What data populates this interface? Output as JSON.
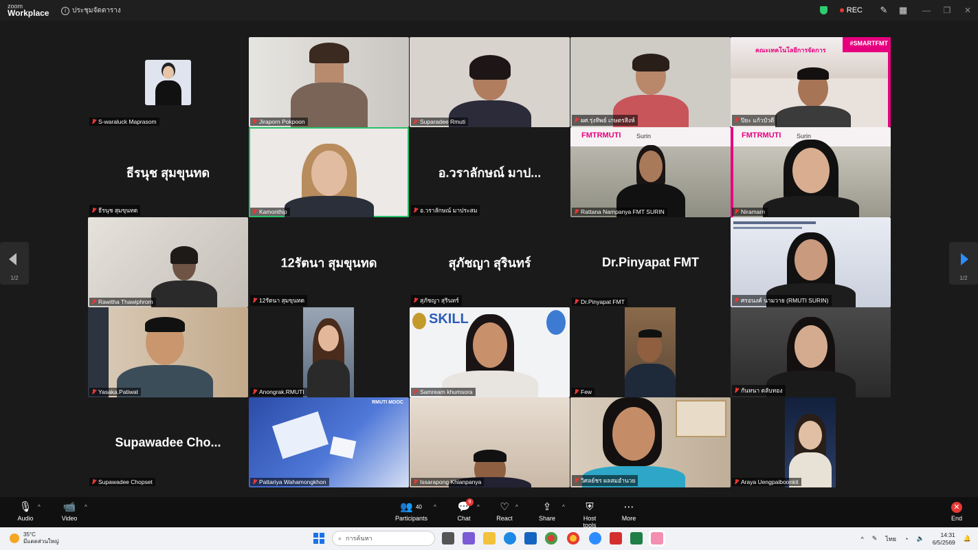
{
  "app": {
    "logo_line1": "zoom",
    "logo_line2": "Workplace",
    "meeting_title": "ประชุมจัดตาราง",
    "rec_label": "REC"
  },
  "pager": {
    "page": "1/2"
  },
  "tiles": [
    {
      "name": "S-waraluck Maprasom"
    },
    {
      "name": "Jiraporn Pokpoon"
    },
    {
      "name": "Suparadee Rmuti"
    },
    {
      "name": "ผศ.รุ่งทิพย์ เกษตรสิงห์"
    },
    {
      "name": "ปิยะ แก้วบัวดี"
    },
    {
      "name": "ธีรนุช สุมขุนทด",
      "display": "ธีรนุช  สุมขุนทด"
    },
    {
      "name": "Kamonthip"
    },
    {
      "name": "อ.วราลักษณ์ มาประสม",
      "display": "อ.วราลักษณ์  มาป..."
    },
    {
      "name": "Rattana Nampanya FMT SURIN"
    },
    {
      "name": "Niramarn"
    },
    {
      "name": "Rawitha Thawiphrom"
    },
    {
      "name": "12รัตนา สุมขุนทด",
      "display": "12รัตนา สุมขุนทด"
    },
    {
      "name": "สุภัชญา สุรินทร์",
      "display": "สุภัชญา สุรินทร์"
    },
    {
      "name": "Dr.Pinyapat FMT",
      "display": "Dr.Pinyapat FMT"
    },
    {
      "name": "ศรอนงค์ นามวาย (RMUTI SURIN)"
    },
    {
      "name": "Yasaka.Patiwat"
    },
    {
      "name": "Anongrak.RMUTI"
    },
    {
      "name": "Samream khumsora"
    },
    {
      "name": "Few"
    },
    {
      "name": "กันทนา ตลับทอง"
    },
    {
      "name": "Supawadee Chopset",
      "display": "Supawadee  Cho..."
    },
    {
      "name": "Pattariya Wahamongkhon"
    },
    {
      "name": "Issarapong Khianpanya"
    },
    {
      "name": "วิศลย์ชร ผลสมอำนวย"
    },
    {
      "name": "Araya Uengpaiboonkit"
    }
  ],
  "backgrounds": {
    "smartfmt_tag": "#SMARTFMT",
    "faculty_banner": "คณะเทคโนโลยีการจัดการ",
    "fmt_logo": "FMTRMUTI",
    "fmt_sub": "Surin",
    "skill_sign": "SKILL",
    "mooc": "RMUTI MOOC"
  },
  "toolbar": {
    "audio": "Audio",
    "video": "Video",
    "participants": "Participants",
    "participants_count": "40",
    "chat": "Chat",
    "chat_badge": "9",
    "react": "React",
    "share": "Share",
    "host_tools": "Host tools",
    "more": "More",
    "end": "End"
  },
  "taskbar": {
    "temperature": "35°C",
    "weather": "มีแดดส่วนใหญ่",
    "search_placeholder": "การค้นหา",
    "language": "ไทย",
    "time": "14:31",
    "date": "6/5/2569"
  },
  "colors": {
    "active_speaker": "#27c26a",
    "rec": "#e53935",
    "fmt_pink": "#e6007e"
  }
}
